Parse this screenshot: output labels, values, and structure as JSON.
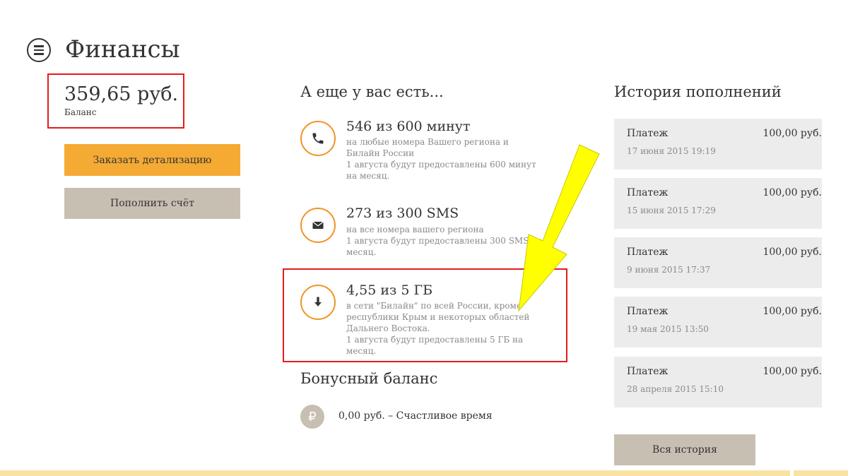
{
  "header": {
    "title": "Финансы",
    "menu_icon": "hamburger-menu-icon"
  },
  "balance": {
    "amount": "359,65 руб.",
    "label": "Баланс"
  },
  "actions": {
    "details": "Заказать детализацию",
    "top_up": "Пополнить счёт"
  },
  "packages": {
    "title": "А еще у вас есть...",
    "items": [
      {
        "icon": "phone-icon",
        "title": "546 из 600 минут",
        "desc1": "на любые номера Вашего региона и Билайн России",
        "desc2": "1 августа будут предоставлены 600 минут на месяц."
      },
      {
        "icon": "envelope-icon",
        "title": "273 из 300 SMS",
        "desc1": "на все номера вашего региона",
        "desc2": "1 августа будут предоставлены 300 SMS на месяц."
      },
      {
        "icon": "download-arrow-icon",
        "title": "4,55 из 5 ГБ",
        "desc1": "в сети \"Билайн\" по всей России, кроме республики Крым и некоторых областей Дальнего Востока.",
        "desc2": "1 августа будут предоставлены 5 ГБ на месяц."
      }
    ]
  },
  "bonus": {
    "title": "Бонусный баланс",
    "icon_glyph": "₽",
    "text": "0,00 руб. – Счастливое время"
  },
  "history": {
    "title": "История пополнений",
    "items": [
      {
        "label": "Платеж",
        "amount": "100,00 руб.",
        "date": "17 июня 2015 19:19"
      },
      {
        "label": "Платеж",
        "amount": "100,00 руб.",
        "date": "15 июня 2015 17:29"
      },
      {
        "label": "Платеж",
        "amount": "100,00 руб.",
        "date": "9 июня 2015 17:37"
      },
      {
        "label": "Платеж",
        "amount": "100,00 руб.",
        "date": "19 мая 2015 13:50"
      },
      {
        "label": "Платеж",
        "amount": "100,00 руб.",
        "date": "28 апреля 2015 15:10"
      }
    ],
    "all_button": "Вся история"
  },
  "colors": {
    "accent": "#f5aa34",
    "icon_ring": "#f29323",
    "highlight": "#e41c1c",
    "annotation_arrow": "#ffff00",
    "button_grey": "#c8bfb3"
  }
}
